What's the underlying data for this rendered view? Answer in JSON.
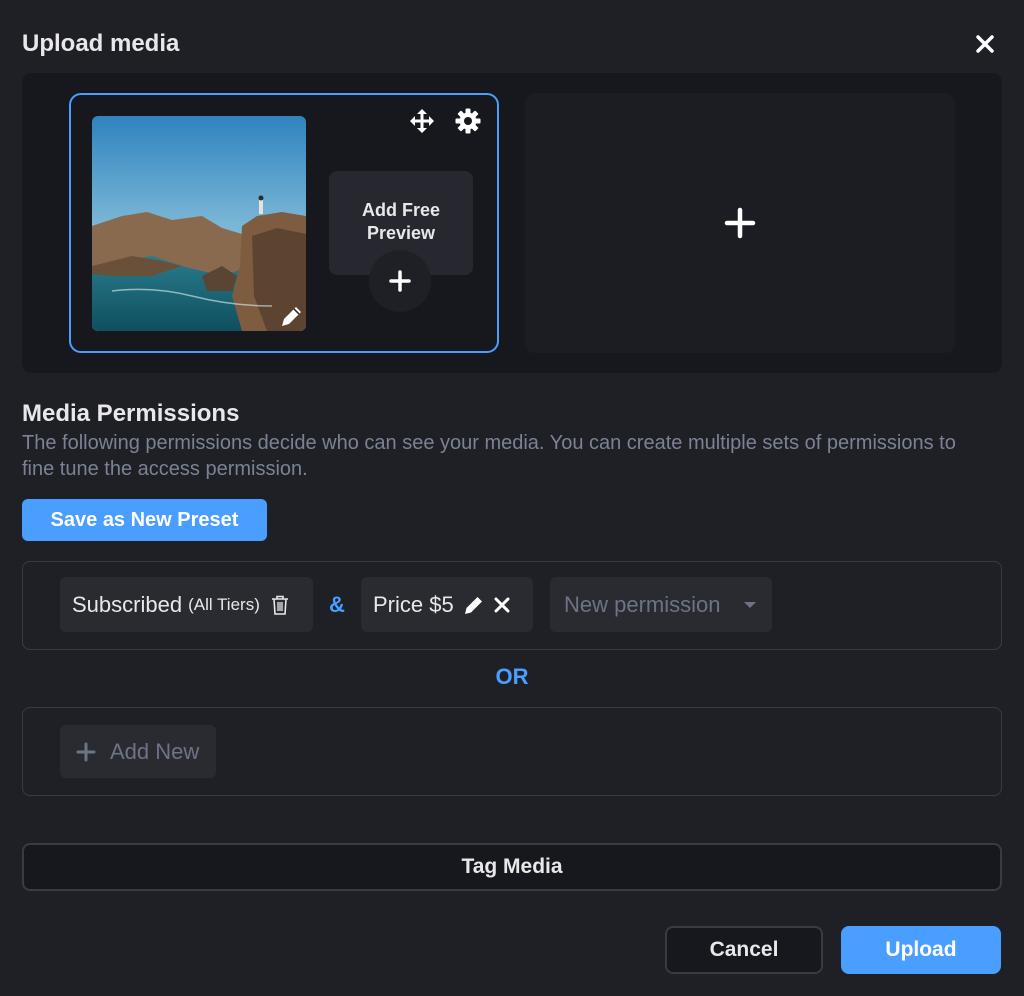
{
  "dialog": {
    "title": "Upload media"
  },
  "media": {
    "free_preview_label": "Add Free Preview",
    "thumbnail_alt": "Coastal cliffs with person standing on rock"
  },
  "permissions": {
    "title": "Media Permissions",
    "description": "The following permissions decide who can see your media. You can create multiple sets of permissions to fine tune the access permission.",
    "save_preset_label": "Save as New Preset",
    "set1": {
      "subscribed_label": "Subscribed",
      "subscribed_tiers": "(All Tiers)",
      "joiner": "&",
      "price_label": "Price $5",
      "new_permission_placeholder": "New permission"
    },
    "or_label": "OR",
    "add_new_label": "Add New"
  },
  "actions": {
    "tag_media_label": "Tag Media",
    "cancel_label": "Cancel",
    "upload_label": "Upload"
  },
  "colors": {
    "background": "#1f2026",
    "accent": "#4a9eff",
    "panel": "#17181d",
    "chip": "#2a2b31",
    "muted_text": "#7b8294"
  }
}
